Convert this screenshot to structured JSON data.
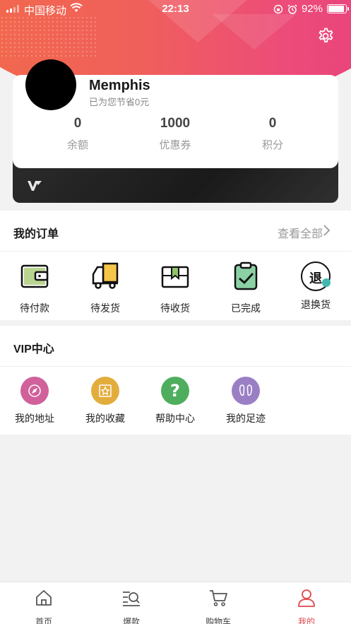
{
  "status_bar": {
    "carrier": "中国移动",
    "time": "22:13",
    "battery": "92%"
  },
  "profile": {
    "name": "Memphis",
    "subtitle": "已为您节省0元"
  },
  "stats": [
    {
      "value": "0",
      "label": "余额"
    },
    {
      "value": "1000",
      "label": "优惠券"
    },
    {
      "value": "0",
      "label": "积分"
    }
  ],
  "orders": {
    "title": "我的订单",
    "view_all": "查看全部",
    "items": [
      {
        "label": "待付款",
        "icon": "wallet-icon"
      },
      {
        "label": "待发货",
        "icon": "delivery-truck-icon"
      },
      {
        "label": "待收货",
        "icon": "package-box-icon"
      },
      {
        "label": "已完成",
        "icon": "clipboard-check-icon"
      },
      {
        "label": "退换货",
        "icon": "return-icon",
        "icon_char": "退"
      }
    ]
  },
  "vip": {
    "title": "VIP中心",
    "items": [
      {
        "label": "我的地址",
        "icon": "compass-icon",
        "color": "#d0619b"
      },
      {
        "label": "我的收藏",
        "icon": "favorite-star-icon",
        "color": "#e3ad3d"
      },
      {
        "label": "帮助中心",
        "icon": "question-icon",
        "color": "#4fae5d"
      },
      {
        "label": "我的足迹",
        "icon": "footprint-icon",
        "color": "#9b7fc4"
      }
    ]
  },
  "tabbar": [
    {
      "label": "首页",
      "icon": "home-icon",
      "active": false
    },
    {
      "label": "爆款",
      "icon": "search-list-icon",
      "active": false
    },
    {
      "label": "购物车",
      "icon": "cart-icon",
      "active": false
    },
    {
      "label": "我的",
      "icon": "user-icon",
      "active": true
    }
  ],
  "colors": {
    "accent": "#e2474b",
    "header_start": "#f26a4a",
    "header_end": "#e8407e"
  }
}
